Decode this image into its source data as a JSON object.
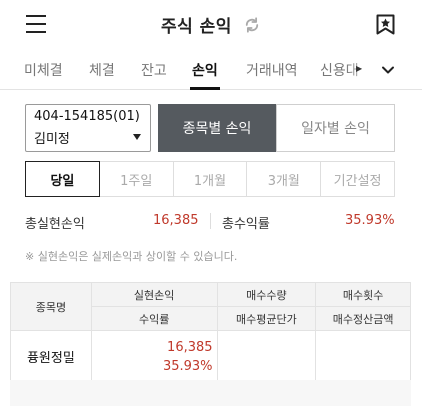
{
  "header": {
    "title": "주식 손익",
    "menu_icon": "hamburger-menu-icon",
    "refresh_icon": "refresh-icon",
    "bookmark_icon": "bookmark-star-icon"
  },
  "tabs": [
    {
      "label": "미체결"
    },
    {
      "label": "체결"
    },
    {
      "label": "잔고"
    },
    {
      "label": "손익"
    },
    {
      "label": "거래내역"
    },
    {
      "label": "신용대"
    }
  ],
  "active_tab": "손익",
  "account": {
    "number": "404-154185(01)",
    "name": "김미정"
  },
  "view_toggle": {
    "by_stock": "종목별 손익",
    "by_date": "일자별 손익"
  },
  "periods": [
    "당일",
    "1주일",
    "1개월",
    "3개월",
    "기간설정"
  ],
  "summary": {
    "realized_label": "총실현손익",
    "realized_value": "16,385",
    "return_label": "총수익률",
    "return_value": "35.93%"
  },
  "note": "※ 실현손익은 실제손익과 상이할 수 있습니다.",
  "table": {
    "headers": {
      "stock": "종목명",
      "realized": "실현손익",
      "return_rate": "수익률",
      "buy_qty": "매수수량",
      "buy_avg_price": "매수평균단가",
      "buy_count": "매수횟수",
      "buy_settle_amount": "매수정산금액"
    },
    "rows": [
      {
        "stock": "퓽원정밀",
        "realized": "16,385",
        "return_rate": "35.93%"
      }
    ]
  },
  "colors": {
    "accent_dark": "#555a5f",
    "profit": "#c0392b"
  }
}
